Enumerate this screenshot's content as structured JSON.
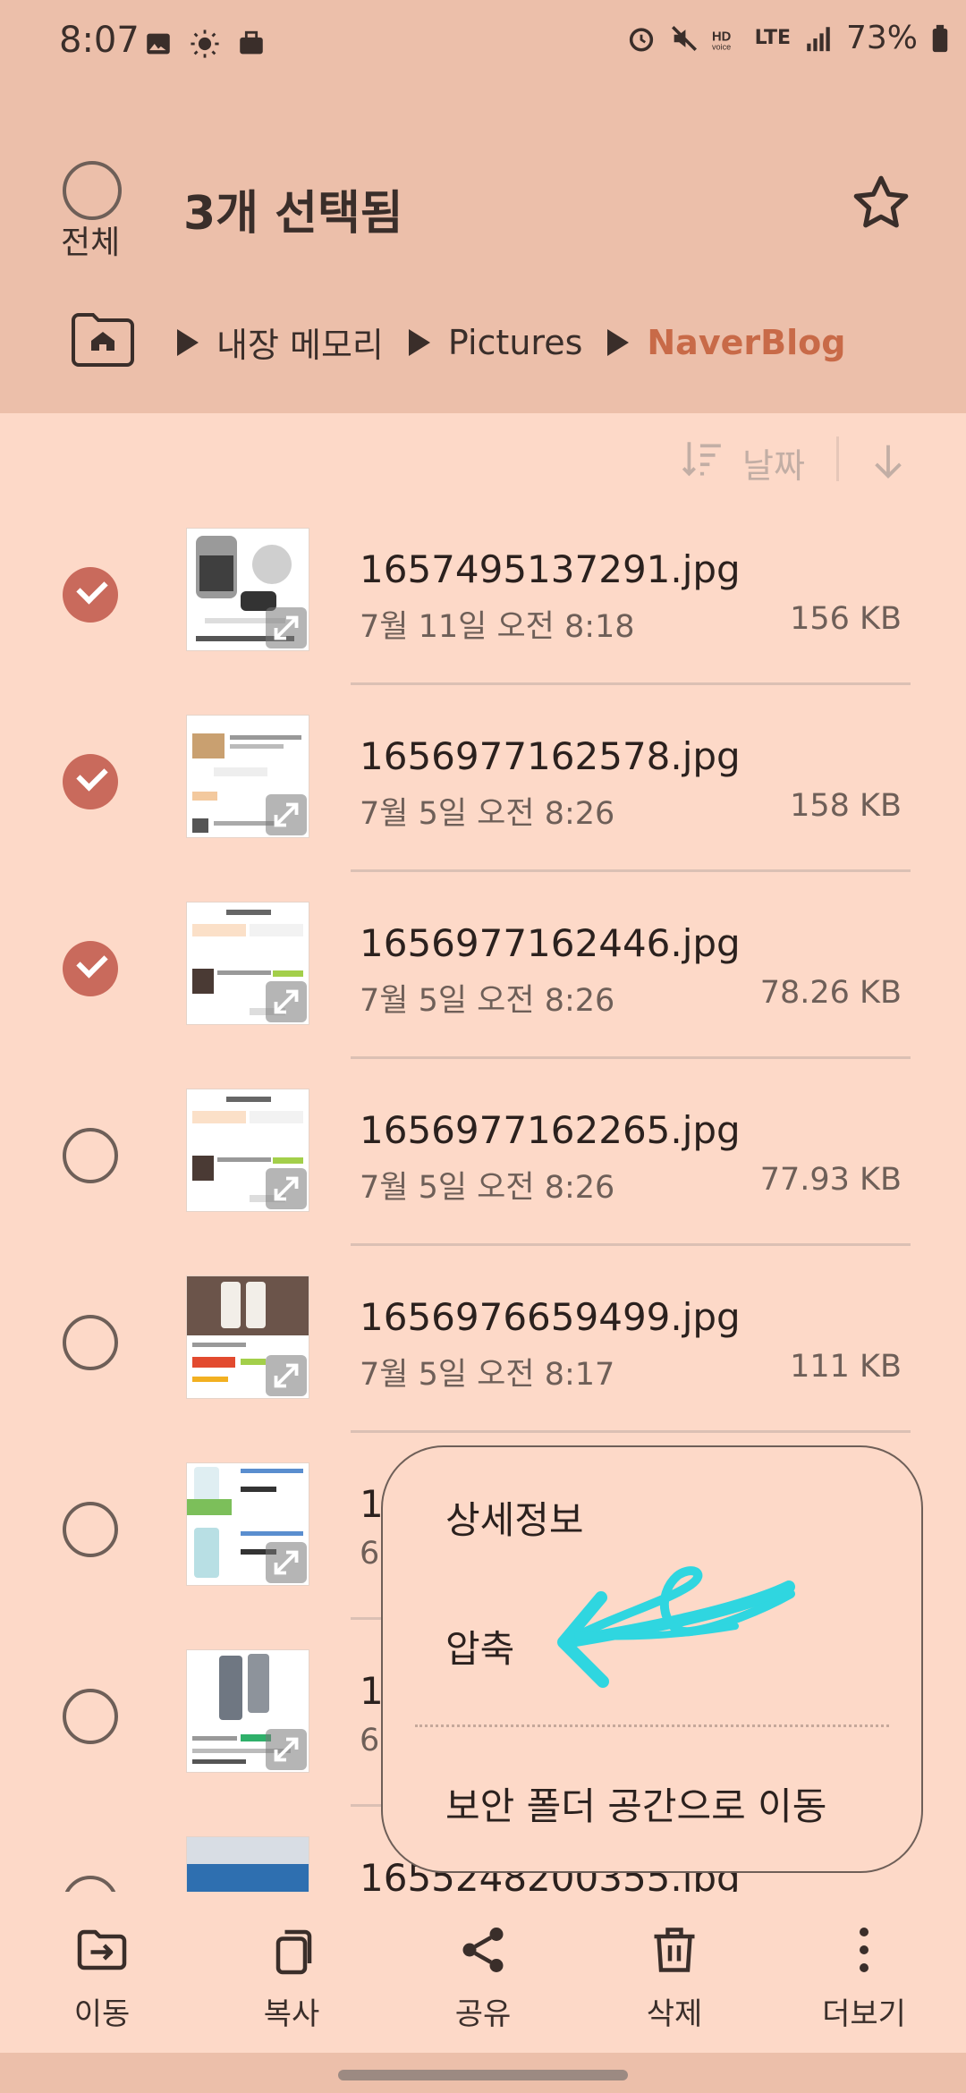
{
  "status_bar": {
    "time": "8:07",
    "battery": "73%",
    "network": "LTE"
  },
  "header": {
    "select_all_label": "전체",
    "title": "3개 선택됨",
    "breadcrumb": [
      "내장 메모리",
      "Pictures",
      "NaverBlog"
    ]
  },
  "sort": {
    "label": "날짜"
  },
  "files": [
    {
      "name": "1657495137291.jpg",
      "date": "7월 11일 오전 8:18",
      "size": "156 KB",
      "checked": true
    },
    {
      "name": "1656977162578.jpg",
      "date": "7월 5일 오전 8:26",
      "size": "158 KB",
      "checked": true
    },
    {
      "name": "1656977162446.jpg",
      "date": "7월 5일 오전 8:26",
      "size": "78.26 KB",
      "checked": true
    },
    {
      "name": "1656977162265.jpg",
      "date": "7월 5일 오전 8:26",
      "size": "77.93 KB",
      "checked": false
    },
    {
      "name": "1656976659499.jpg",
      "date": "7월 5일 오전 8:17",
      "size": "111 KB",
      "checked": false
    },
    {
      "name": "1",
      "date": "6",
      "size": "",
      "checked": false
    },
    {
      "name": "1",
      "date": "6",
      "size": "",
      "checked": false
    },
    {
      "name": "1655248200355.jpg",
      "date": "",
      "size": "",
      "checked": false
    }
  ],
  "context_menu": {
    "items": [
      "상세정보",
      "압축",
      "보안 폴더 공간으로 이동"
    ]
  },
  "bottom_actions": [
    "이동",
    "복사",
    "공유",
    "삭제",
    "더보기"
  ],
  "colors": {
    "header_bg": "#ecbfaa",
    "body_bg": "#fdd9c8",
    "accent": "#c86a48",
    "check": "#c96a5c",
    "scribble": "#2fd6e0"
  }
}
